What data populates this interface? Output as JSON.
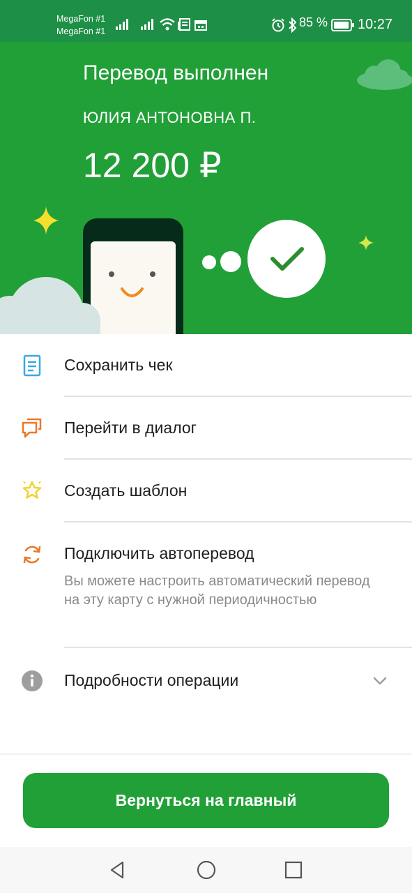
{
  "status_bar": {
    "carrier_1": "MegaFon #1",
    "carrier_2": "MegaFon #1",
    "battery": "85 %",
    "time": "10:27",
    "icons": [
      "signal-icon",
      "signal-icon",
      "wifi-icon",
      "news-icon",
      "calendar-icon",
      "alarm-icon",
      "bluetooth-icon",
      "battery-icon"
    ]
  },
  "hero": {
    "title": "Перевод выполнен",
    "recipient": "ЮЛИЯ АНТОНОВНА П.",
    "amount": "12 200 ₽"
  },
  "actions": [
    {
      "label": "Сохранить чек",
      "icon": "receipt-icon",
      "color": "#3aa6e6"
    },
    {
      "label": "Перейти в диалог",
      "icon": "chat-icon",
      "color": "#e8782a"
    },
    {
      "label": "Создать шаблон",
      "icon": "star-icon",
      "color": "#f2d22e"
    },
    {
      "label": "Подключить автоперевод",
      "sublabel": "Вы можете настроить автоматический перевод на эту карту с нужной периодичностью",
      "icon": "refresh-icon",
      "color": "#e8782a"
    },
    {
      "label": "Подробности операции",
      "icon": "info-icon",
      "color": "#9e9e9e"
    }
  ],
  "cta": {
    "label": "Вернуться на главный"
  },
  "colors": {
    "brand_green": "#21a038",
    "status_green": "#1e8f46"
  }
}
